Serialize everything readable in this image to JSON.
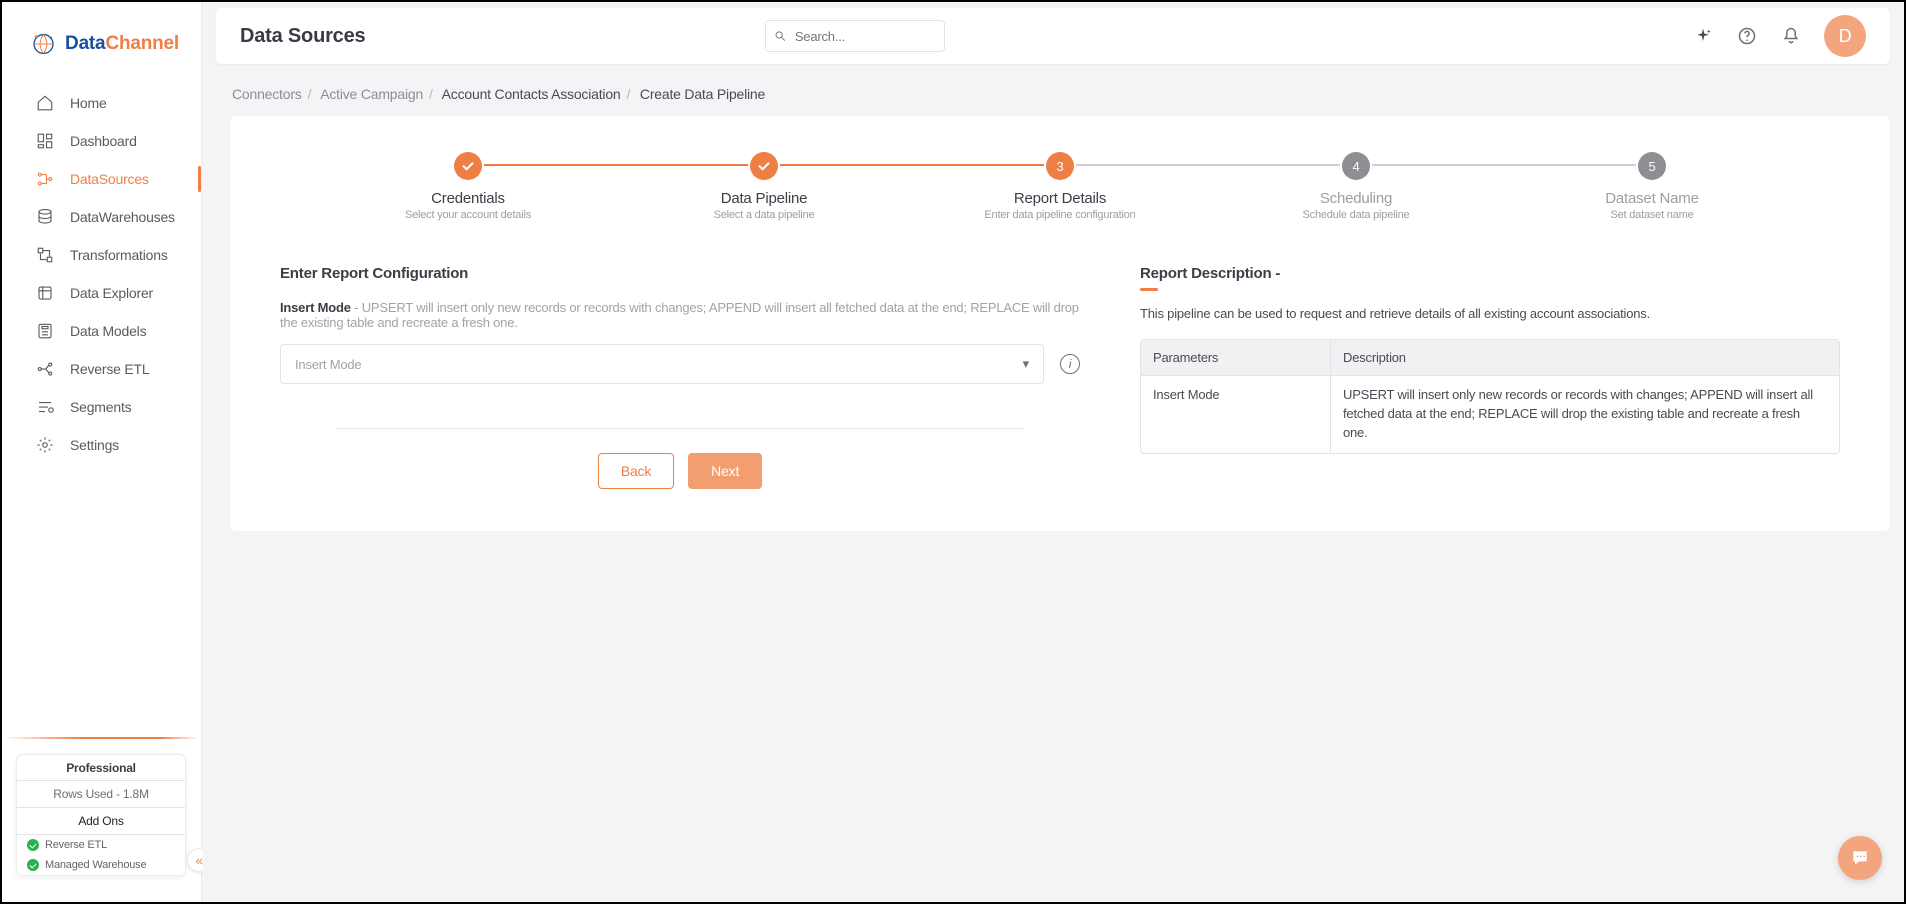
{
  "brand": {
    "part1": "Data",
    "part2": "Channel"
  },
  "sidebar": {
    "items": [
      {
        "label": "Home"
      },
      {
        "label": "Dashboard"
      },
      {
        "label": "DataSources"
      },
      {
        "label": "DataWarehouses"
      },
      {
        "label": "Transformations"
      },
      {
        "label": "Data Explorer"
      },
      {
        "label": "Data Models"
      },
      {
        "label": "Reverse ETL"
      },
      {
        "label": "Segments"
      },
      {
        "label": "Settings"
      }
    ],
    "plan": {
      "title": "Professional",
      "rows_used": "Rows Used - 1.8M",
      "addons_label": "Add Ons",
      "addons": [
        "Reverse ETL",
        "Managed Warehouse"
      ]
    }
  },
  "header": {
    "title": "Data Sources",
    "search_placeholder": "Search...",
    "avatar_initial": "D"
  },
  "breadcrumbs": [
    "Connectors",
    "Active Campaign",
    "Account Contacts Association",
    "Create Data Pipeline"
  ],
  "steps": [
    {
      "title": "Credentials",
      "sub": "Select your account details"
    },
    {
      "title": "Data Pipeline",
      "sub": "Select a data pipeline"
    },
    {
      "title": "Report Details",
      "sub": "Enter data pipeline configuration",
      "num": "3"
    },
    {
      "title": "Scheduling",
      "sub": "Schedule data pipeline",
      "num": "4"
    },
    {
      "title": "Dataset Name",
      "sub": "Set dataset name",
      "num": "5"
    }
  ],
  "form": {
    "heading": "Enter Report Configuration",
    "label": "Insert Mode",
    "hint": " - UPSERT will insert only new records or records with changes; APPEND will insert all fetched data at the end; REPLACE will drop the existing table and recreate a fresh one.",
    "placeholder": "Insert Mode",
    "back": "Back",
    "next": "Next"
  },
  "right": {
    "heading": "Report Description -",
    "desc": "This pipeline can be used to request and retrieve details of all existing account associations.",
    "col1": "Parameters",
    "col2": "Description",
    "rows": [
      {
        "p": "Insert Mode",
        "d": "UPSERT will insert only new records or records with changes; APPEND will insert all fetched data at the end; REPLACE will drop the existing table and recreate a fresh one."
      }
    ]
  },
  "info_char": "i",
  "collapse": "«"
}
